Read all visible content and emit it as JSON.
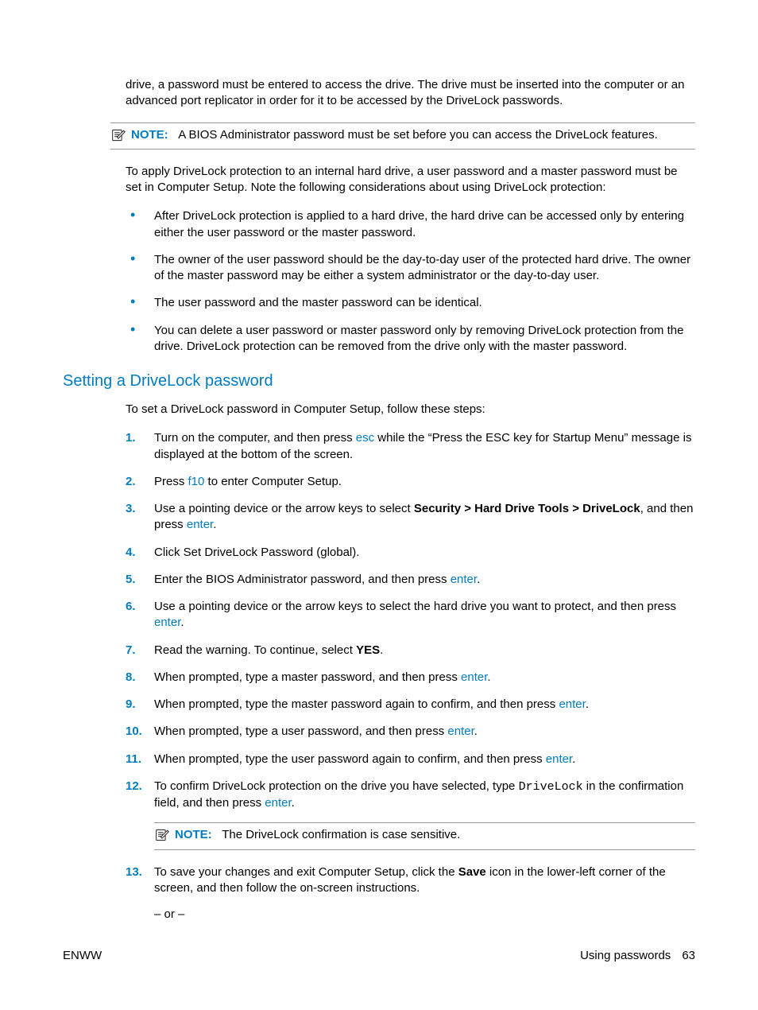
{
  "paragraphs": {
    "intro_continued": "drive, a password must be entered to access the drive. The drive must be inserted into the computer or an advanced port replicator in order for it to be accessed by the DriveLock passwords.",
    "after_note": "To apply DriveLock protection to an internal hard drive, a user password and a master password must be set in Computer Setup. Note the following considerations about using DriveLock protection:",
    "setting_intro": "To set a DriveLock password in Computer Setup, follow these steps:",
    "or_text": "– or –"
  },
  "notes": {
    "note_label": "NOTE:",
    "bios_admin": "A BIOS Administrator password must be set before you can access the DriveLock features.",
    "case_sensitive": "The DriveLock confirmation is case sensitive."
  },
  "bullets": {
    "b1": "After DriveLock protection is applied to a hard drive, the hard drive can be accessed only by entering either the user password or the master password.",
    "b2": "The owner of the user password should be the day-to-day user of the protected hard drive. The owner of the master password may be either a system administrator or the day-to-day user.",
    "b3": "The user password and the master password can be identical.",
    "b4": "You can delete a user password or master password only by removing DriveLock protection from the drive. DriveLock protection can be removed from the drive only with the master password."
  },
  "heading": "Setting a DriveLock password",
  "steps": {
    "s1_a": "Turn on the computer, and then press ",
    "s1_kbd": "esc",
    "s1_b": " while the “Press the ESC key for Startup Menu” message is displayed at the bottom of the screen.",
    "s2_a": "Press ",
    "s2_kbd": "f10",
    "s2_b": " to enter Computer Setup.",
    "s3_a": "Use a pointing device or the arrow keys to select ",
    "s3_bold": "Security > Hard Drive Tools > DriveLock",
    "s3_b": ", and then press ",
    "s3_kbd": "enter",
    "s3_c": ".",
    "s4": "Click Set DriveLock Password (global).",
    "s5_a": "Enter the BIOS Administrator password, and then press ",
    "s5_kbd": "enter",
    "s5_b": ".",
    "s6_a": "Use a pointing device or the arrow keys to select the hard drive you want to protect, and then press ",
    "s6_kbd": "enter",
    "s6_b": ".",
    "s7_a": "Read the warning. To continue, select ",
    "s7_bold": "YES",
    "s7_b": ".",
    "s8_a": "When prompted, type a master password, and then press ",
    "s8_kbd": "enter",
    "s8_b": ".",
    "s9_a": "When prompted, type the master password again to confirm, and then press ",
    "s9_kbd": "enter",
    "s9_b": ".",
    "s10_a": "When prompted, type a user password, and then press ",
    "s10_kbd": "enter",
    "s10_b": ".",
    "s11_a": "When prompted, type the user password again to confirm, and then press ",
    "s11_kbd": "enter",
    "s11_b": ".",
    "s12_a": "To confirm DriveLock protection on the drive you have selected, type ",
    "s12_mono": "DriveLock",
    "s12_b": " in the confirmation field, and then press ",
    "s12_kbd": "enter",
    "s12_c": ".",
    "s13_a": "To save your changes and exit Computer Setup, click the ",
    "s13_bold": "Save",
    "s13_b": " icon in the lower-left corner of the screen, and then follow the on-screen instructions."
  },
  "numbers": {
    "n1": "1.",
    "n2": "2.",
    "n3": "3.",
    "n4": "4.",
    "n5": "5.",
    "n6": "6.",
    "n7": "7.",
    "n8": "8.",
    "n9": "9.",
    "n10": "10.",
    "n11": "11.",
    "n12": "12.",
    "n13": "13."
  },
  "footer": {
    "left": "ENWW",
    "right_section": "Using passwords",
    "pagenum": "63"
  }
}
